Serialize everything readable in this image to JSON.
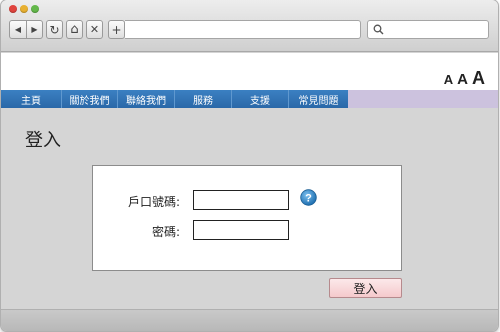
{
  "toolbar": {
    "back_icon": "◀",
    "forward_icon": "▶",
    "reload_icon": "↻",
    "home_icon": "⌂",
    "stop_icon": "✕",
    "newtab_icon": "+"
  },
  "address": {
    "url": ""
  },
  "search": {
    "value": ""
  },
  "font_size": {
    "small": "A",
    "medium": "A",
    "large": "A"
  },
  "menu": {
    "items": [
      {
        "label": "主頁"
      },
      {
        "label": "關於我們"
      },
      {
        "label": "聯絡我們"
      },
      {
        "label": "服務"
      },
      {
        "label": "支援"
      },
      {
        "label": "常見問題"
      }
    ]
  },
  "page": {
    "title": "登入"
  },
  "form": {
    "account_label": "戶口號碼:",
    "account_value": "",
    "password_label": "密碼:",
    "password_value": "",
    "help_icon": "?",
    "submit_label": "登入"
  },
  "colors": {
    "menu_bg": "#2f73b6",
    "menu_tail": "#ccc2de",
    "help_icon": "#2e86c8",
    "submit_bg": "#f5c9cc"
  }
}
